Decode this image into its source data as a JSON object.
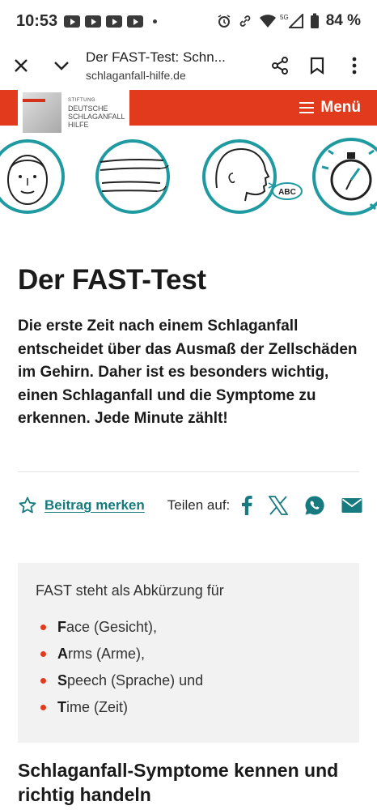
{
  "status_bar": {
    "time": "10:53",
    "network": "5G",
    "battery": "84 %"
  },
  "browser": {
    "page_title": "Der FAST-Test: Schn...",
    "url": "schlaganfall-hilfe.de"
  },
  "site_header": {
    "logo_line1": "STIFTUNG",
    "logo_line2": "DEUTSCHE",
    "logo_line3": "SCHLAGANFALL",
    "logo_line4": "HILFE",
    "menu_label": "Menü",
    "brand_color": "#e23a1c"
  },
  "fast_icons": [
    {
      "name": "face-icon"
    },
    {
      "name": "arms-icon"
    },
    {
      "name": "speech-icon",
      "badge": "ABC"
    },
    {
      "name": "stopwatch-icon"
    }
  ],
  "article": {
    "title": "Der FAST-Test",
    "lead": "Die erste Zeit nach einem Schlaganfall entscheidet über das Ausmaß der Zellschäden im Gehirn. Daher ist es besonders wichtig, einen Schlaganfall und die Symptome zu erkennen. Jede Minute zählt!",
    "bookmark_label": "Beitrag merken",
    "share_label": "Teilen auf:",
    "share_targets": [
      "facebook-icon",
      "x-icon",
      "whatsapp-icon",
      "email-icon"
    ],
    "accent_color": "#167a7f"
  },
  "info_box": {
    "intro": "FAST steht als Abkürzung für",
    "items": [
      {
        "letter": "F",
        "rest": "ace",
        "translation": "(Gesicht),"
      },
      {
        "letter": "A",
        "rest": "rms",
        "translation": "(Arme),"
      },
      {
        "letter": "S",
        "rest": "peech",
        "translation": "(Sprache) und"
      },
      {
        "letter": "T",
        "rest": "ime",
        "translation": "(Zeit)"
      }
    ]
  },
  "section": {
    "title": "Schlaganfall-Symptome kennen und richtig handeln"
  }
}
